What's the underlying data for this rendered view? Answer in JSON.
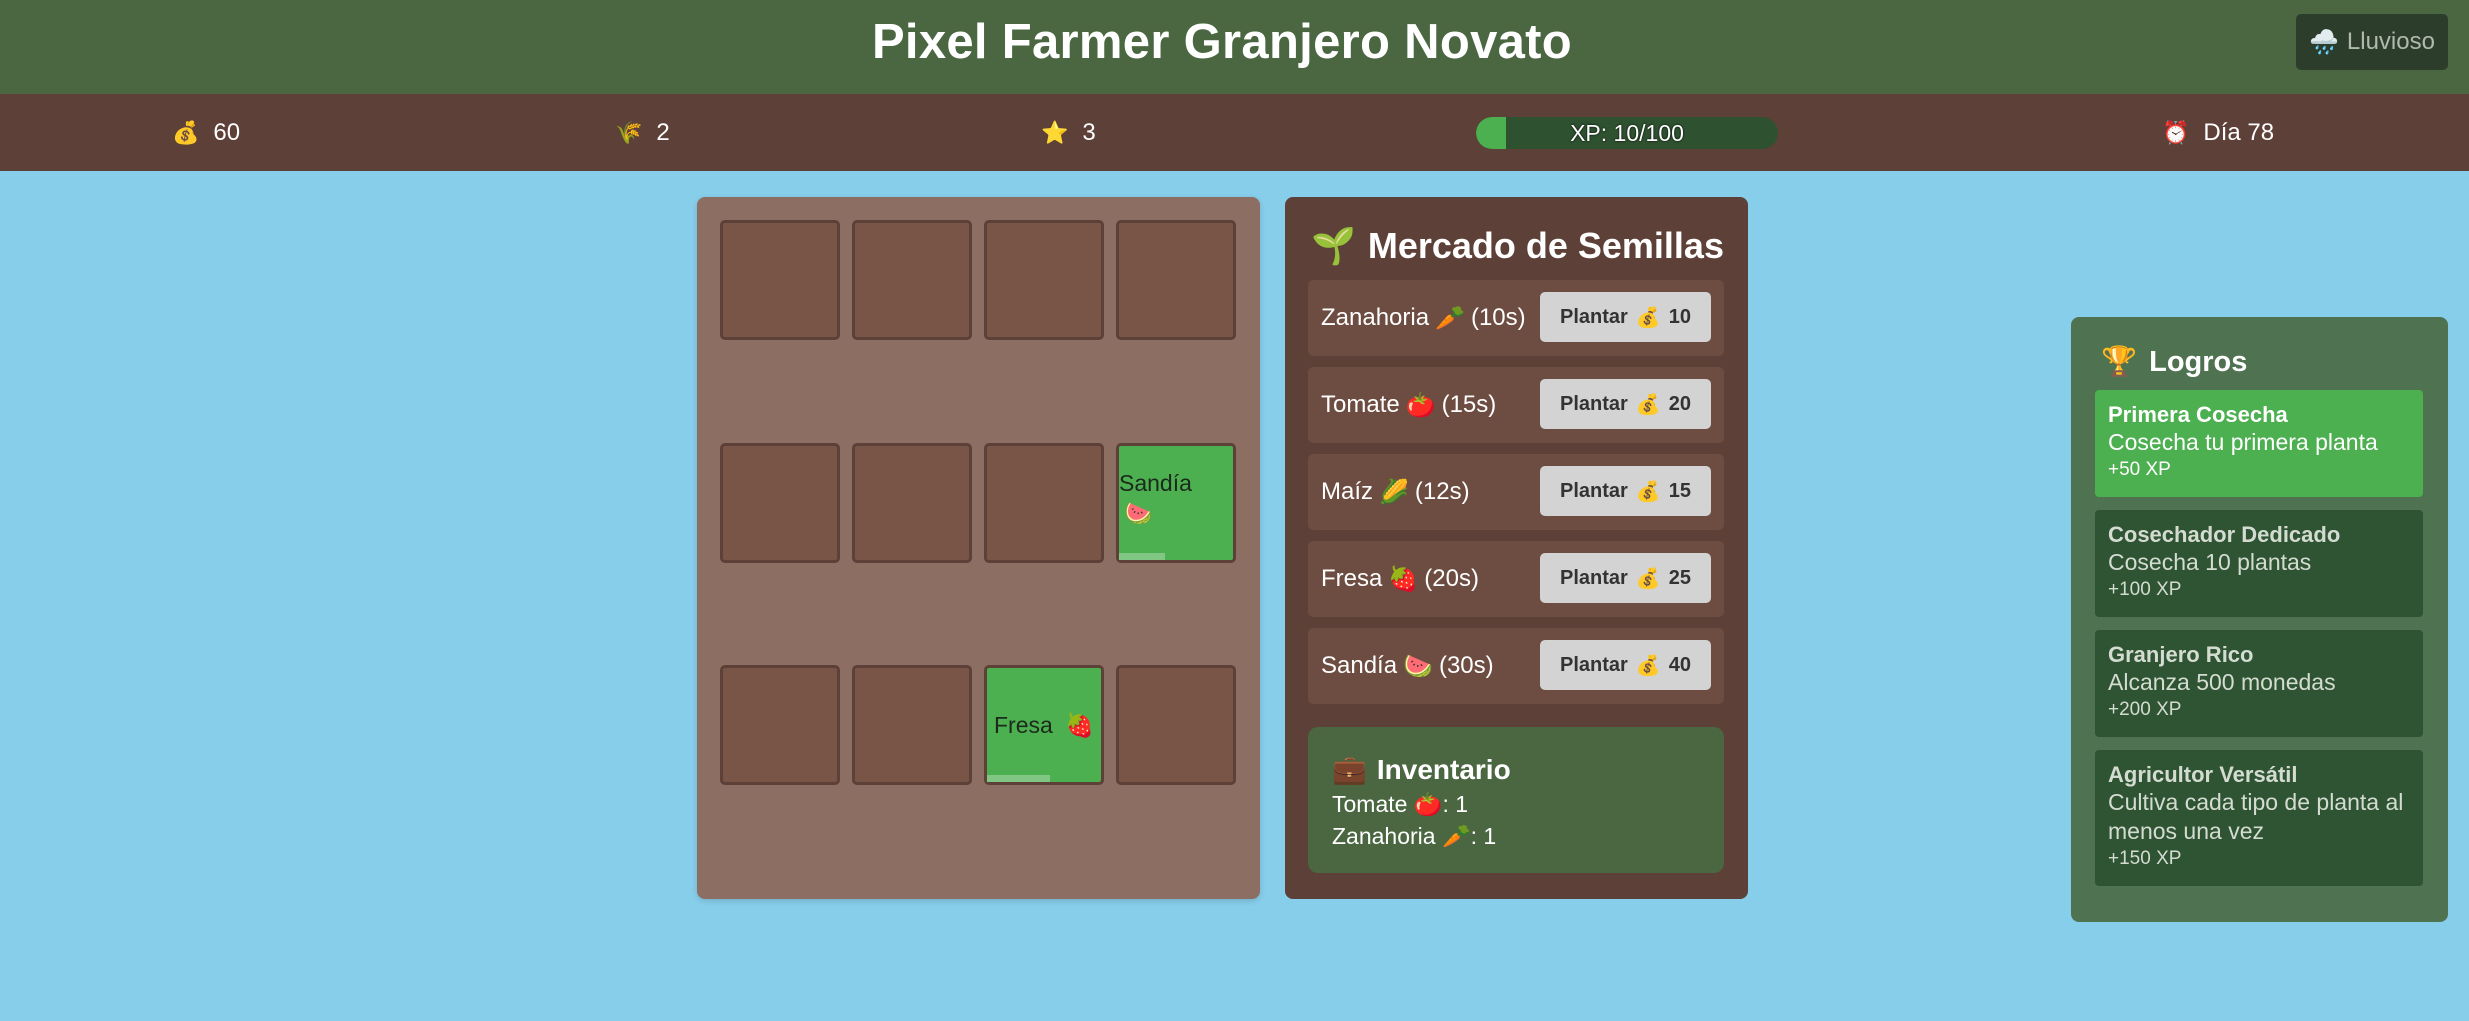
{
  "header": {
    "title": "Pixel Farmer Granjero Novato",
    "weather_icon": "🌧️",
    "weather_label": "Lluvioso"
  },
  "stats": {
    "coins_icon": "💰",
    "coins": "60",
    "harvest_icon": "🌾",
    "harvest": "2",
    "level_icon": "⭐",
    "level": "3",
    "xp_text": "XP: 10/100",
    "xp_fraction": 0.1,
    "day_icon": "⏰",
    "day": "Día 78"
  },
  "farm": {
    "plot_sandia": {
      "label": "Sandía",
      "icon": "🍉",
      "growth": 0.4
    },
    "plot_fresa": {
      "label": "Fresa",
      "icon": "🍓",
      "growth": 0.55
    }
  },
  "market": {
    "icon": "🌱",
    "title": "Mercado de Semillas",
    "button_label": "Plantar",
    "coin_icon": "💰",
    "seeds": [
      {
        "name": "Zanahoria",
        "icon": "🥕",
        "time": "(10s)",
        "price": "10"
      },
      {
        "name": "Tomate",
        "icon": "🍅",
        "time": "(15s)",
        "price": "20"
      },
      {
        "name": "Maíz",
        "icon": "🌽",
        "time": "(12s)",
        "price": "15"
      },
      {
        "name": "Fresa",
        "icon": "🍓",
        "time": "(20s)",
        "price": "25"
      },
      {
        "name": "Sandía",
        "icon": "🍉",
        "time": "(30s)",
        "price": "40"
      }
    ]
  },
  "inventory": {
    "icon": "💼",
    "title": "Inventario",
    "items": [
      {
        "name": "Tomate",
        "icon": "🍅",
        "count": ": 1"
      },
      {
        "name": "Zanahoria",
        "icon": "🥕",
        "count": ": 1"
      }
    ]
  },
  "achievements": {
    "icon": "🏆",
    "title": "Logros",
    "items": [
      {
        "name": "Primera Cosecha",
        "desc": "Cosecha tu primera planta",
        "xp": "+50 XP"
      },
      {
        "name": "Cosechador Dedicado",
        "desc": "Cosecha 10 plantas",
        "xp": "+100 XP"
      },
      {
        "name": "Granjero Rico",
        "desc": "Alcanza 500 monedas",
        "xp": "+200 XP"
      },
      {
        "name": "Agricultor Versátil",
        "desc": "Cultiva cada tipo de planta al menos una vez",
        "xp": "+150 XP"
      }
    ]
  },
  "colors": {
    "header": "#4a6741",
    "stats_bar": "#5d4037",
    "sky": "#87ceeb",
    "planted": "#4caf50",
    "soil": "#795548"
  }
}
